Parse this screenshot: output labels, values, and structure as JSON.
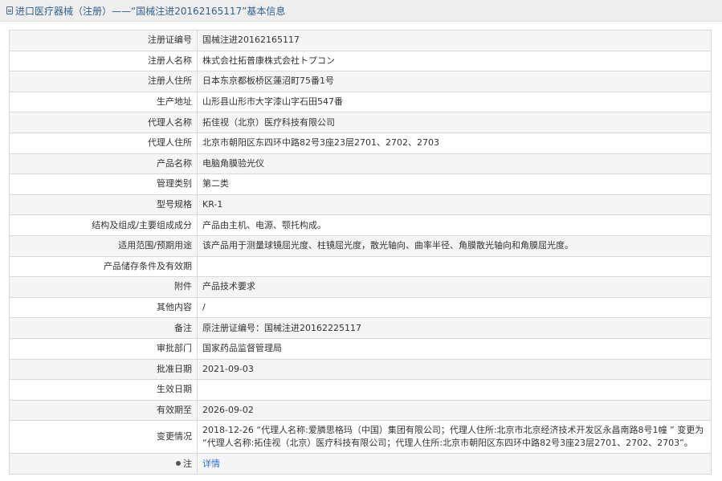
{
  "header": {
    "title": "进口医疗器械（注册）——“国械注进20162165117”基本信息",
    "icon": "document-icon"
  },
  "rows": [
    {
      "label": "注册证编号",
      "value": "国械注进20162165117"
    },
    {
      "label": "注册人名称",
      "value": "株式会社拓普康株式会社トプコン"
    },
    {
      "label": "注册人住所",
      "value": "日本东京都板桥区蓮沼町75番1号"
    },
    {
      "label": "生产地址",
      "value": "山形县山形市大字漆山字石田547番"
    },
    {
      "label": "代理人名称",
      "value": "拓佳视（北京）医疗科技有限公司"
    },
    {
      "label": "代理人住所",
      "value": "北京市朝阳区东四环中路82号3座23层2701、2702、2703"
    },
    {
      "label": "产品名称",
      "value": "电脑角膜验光仪"
    },
    {
      "label": "管理类别",
      "value": "第二类"
    },
    {
      "label": "型号规格",
      "value": "KR-1"
    },
    {
      "label": "结构及组成/主要组成成分",
      "value": "产品由主机、电源、颚托构成。"
    },
    {
      "label": "适用范围/预期用途",
      "value": "该产品用于测量球镜屈光度、柱镜屈光度，散光轴向、曲率半径、角膜散光轴向和角膜屈光度。"
    },
    {
      "label": "产品储存条件及有效期",
      "value": ""
    },
    {
      "label": "附件",
      "value": "产品技术要求"
    },
    {
      "label": "其他内容",
      "value": "/"
    },
    {
      "label": "备注",
      "value": "原注册证编号：国械注进20162225117"
    },
    {
      "label": "审批部门",
      "value": "国家药品监督管理局"
    },
    {
      "label": "批准日期",
      "value": "2021-09-03"
    },
    {
      "label": "生效日期",
      "value": ""
    },
    {
      "label": "有效期至",
      "value": "2026-09-02"
    },
    {
      "label": "变更情况",
      "value": "2018-12-26 “代理人名称:爱膦思格玛（中国）集团有限公司；代理人住所:北京市北京经济技术开发区永昌南路8号1幢 ” 变更为 “代理人名称:拓佳视（北京）医疗科技有限公司；代理人住所:北京市朝阳区东四环中路82号3座23层2701、2702、2703”。"
    }
  ],
  "note": {
    "label": "注",
    "link": "详情",
    "icon": "note-icon"
  },
  "colors": {
    "link": "#2a6fd6",
    "stripe": "#f5f5f5",
    "title": "#33618f"
  }
}
